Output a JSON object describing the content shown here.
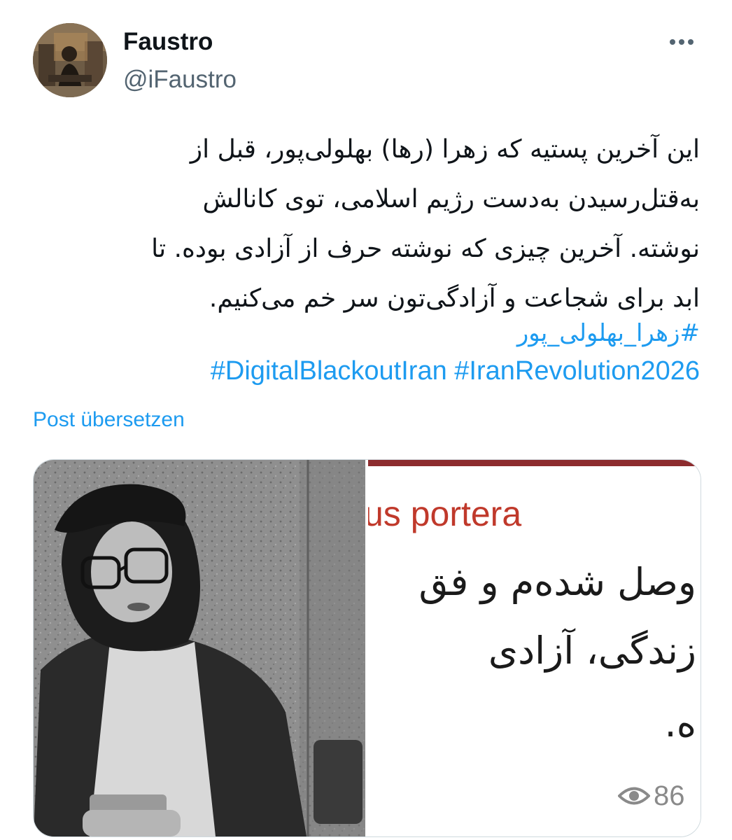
{
  "author": {
    "display_name": "Faustro",
    "handle": "@iFaustro"
  },
  "tweet": {
    "text_lines": [
      "این آخرین پستیه که زهرا (رها) بهلولی‌پور، قبل از",
      "به‌قتل‌رسیدن به‌دست رژیم اسلامی، توی کانالش",
      "نوشته. آخرین چیزی که نوشته حرف از آزادی بوده. تا",
      "ابد برای شجاعت و آزادگی‌تون سر خم می‌کنیم."
    ],
    "hashtag_fa": "#زهرا_بهلولی_پور",
    "hashtags_en": [
      "#DigitalBlackoutIran",
      "#IranRevolution2026"
    ],
    "translate_label": "Post übersetzen"
  },
  "media": {
    "right_image": {
      "latin_text": "us portera",
      "persian_lines": [
        "وصل شده‌م و فق",
        "زندگی، آزادی",
        "ه."
      ],
      "view_count": "86"
    }
  },
  "colors": {
    "text": "#0f1419",
    "secondary": "#536471",
    "link": "#1d9bf0",
    "border": "#cfd9de"
  },
  "icons": {
    "more": "more-horizontal-icon",
    "views": "eye-icon"
  }
}
